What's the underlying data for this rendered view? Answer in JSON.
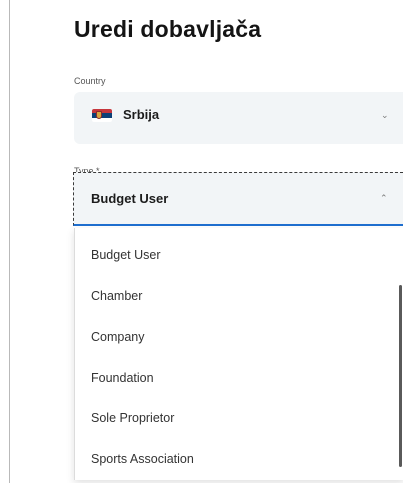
{
  "title": "Uredi dobavljača",
  "country": {
    "label": "Country",
    "value": "Srbija",
    "flag_icon": "serbia-flag-icon",
    "chevron_icon": "chevron-down-icon"
  },
  "type": {
    "label": "Type *",
    "value": "Budget User",
    "chevron_icon": "chevron-up-icon",
    "options": [
      "Budget User",
      "Chamber",
      "Company",
      "Foundation",
      "Sole Proprietor",
      "Sports Association"
    ]
  },
  "colors": {
    "focus_underline": "#1f6fd0",
    "field_background": "#f2f5f7"
  }
}
